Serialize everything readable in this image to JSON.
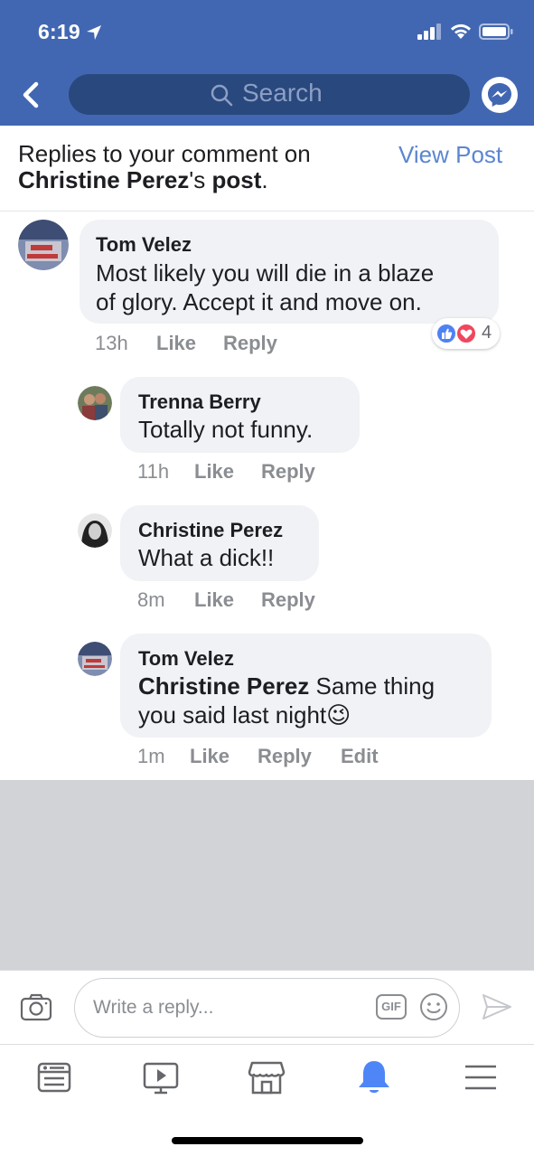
{
  "status_bar": {
    "time": "6:19"
  },
  "nav": {
    "search_placeholder": "Search"
  },
  "header": {
    "prefix": "Replies to your comment on",
    "post_author": "Christine Perez",
    "possessive": "'s ",
    "post_word": "post",
    "suffix": ".",
    "view_post": "View Post"
  },
  "comments": [
    {
      "name": "Tom Velez",
      "text_line1": "Most likely you will die in a blaze",
      "text_line2": "of glory. Accept it and move on.",
      "time": "13h",
      "like": "Like",
      "reply": "Reply",
      "reaction_count": "4"
    },
    {
      "name": "Trenna Berry",
      "text": "Totally not funny.",
      "time": "11h",
      "like": "Like",
      "reply": "Reply"
    },
    {
      "name": "Christine Perez",
      "text": "What a dick!!",
      "time": "8m",
      "like": "Like",
      "reply": "Reply"
    },
    {
      "name": "Tom Velez",
      "mention": "Christine Perez",
      "text_line1": " Same thing",
      "text_line2": "you said last night",
      "emoji": "😉",
      "time": "1m",
      "like": "Like",
      "reply": "Reply",
      "edit": "Edit"
    }
  ],
  "composer": {
    "placeholder": "Write a reply...",
    "gif_label": "GIF"
  },
  "tabs": [
    "news-feed",
    "watch",
    "marketplace",
    "notifications",
    "menu"
  ],
  "colors": {
    "brand_blue": "#4267b2",
    "link_blue": "#5b86d1",
    "active_tab_blue": "#4f86f7",
    "bubble_grey": "#f0f2f5",
    "meta_grey": "#8a8d91"
  }
}
